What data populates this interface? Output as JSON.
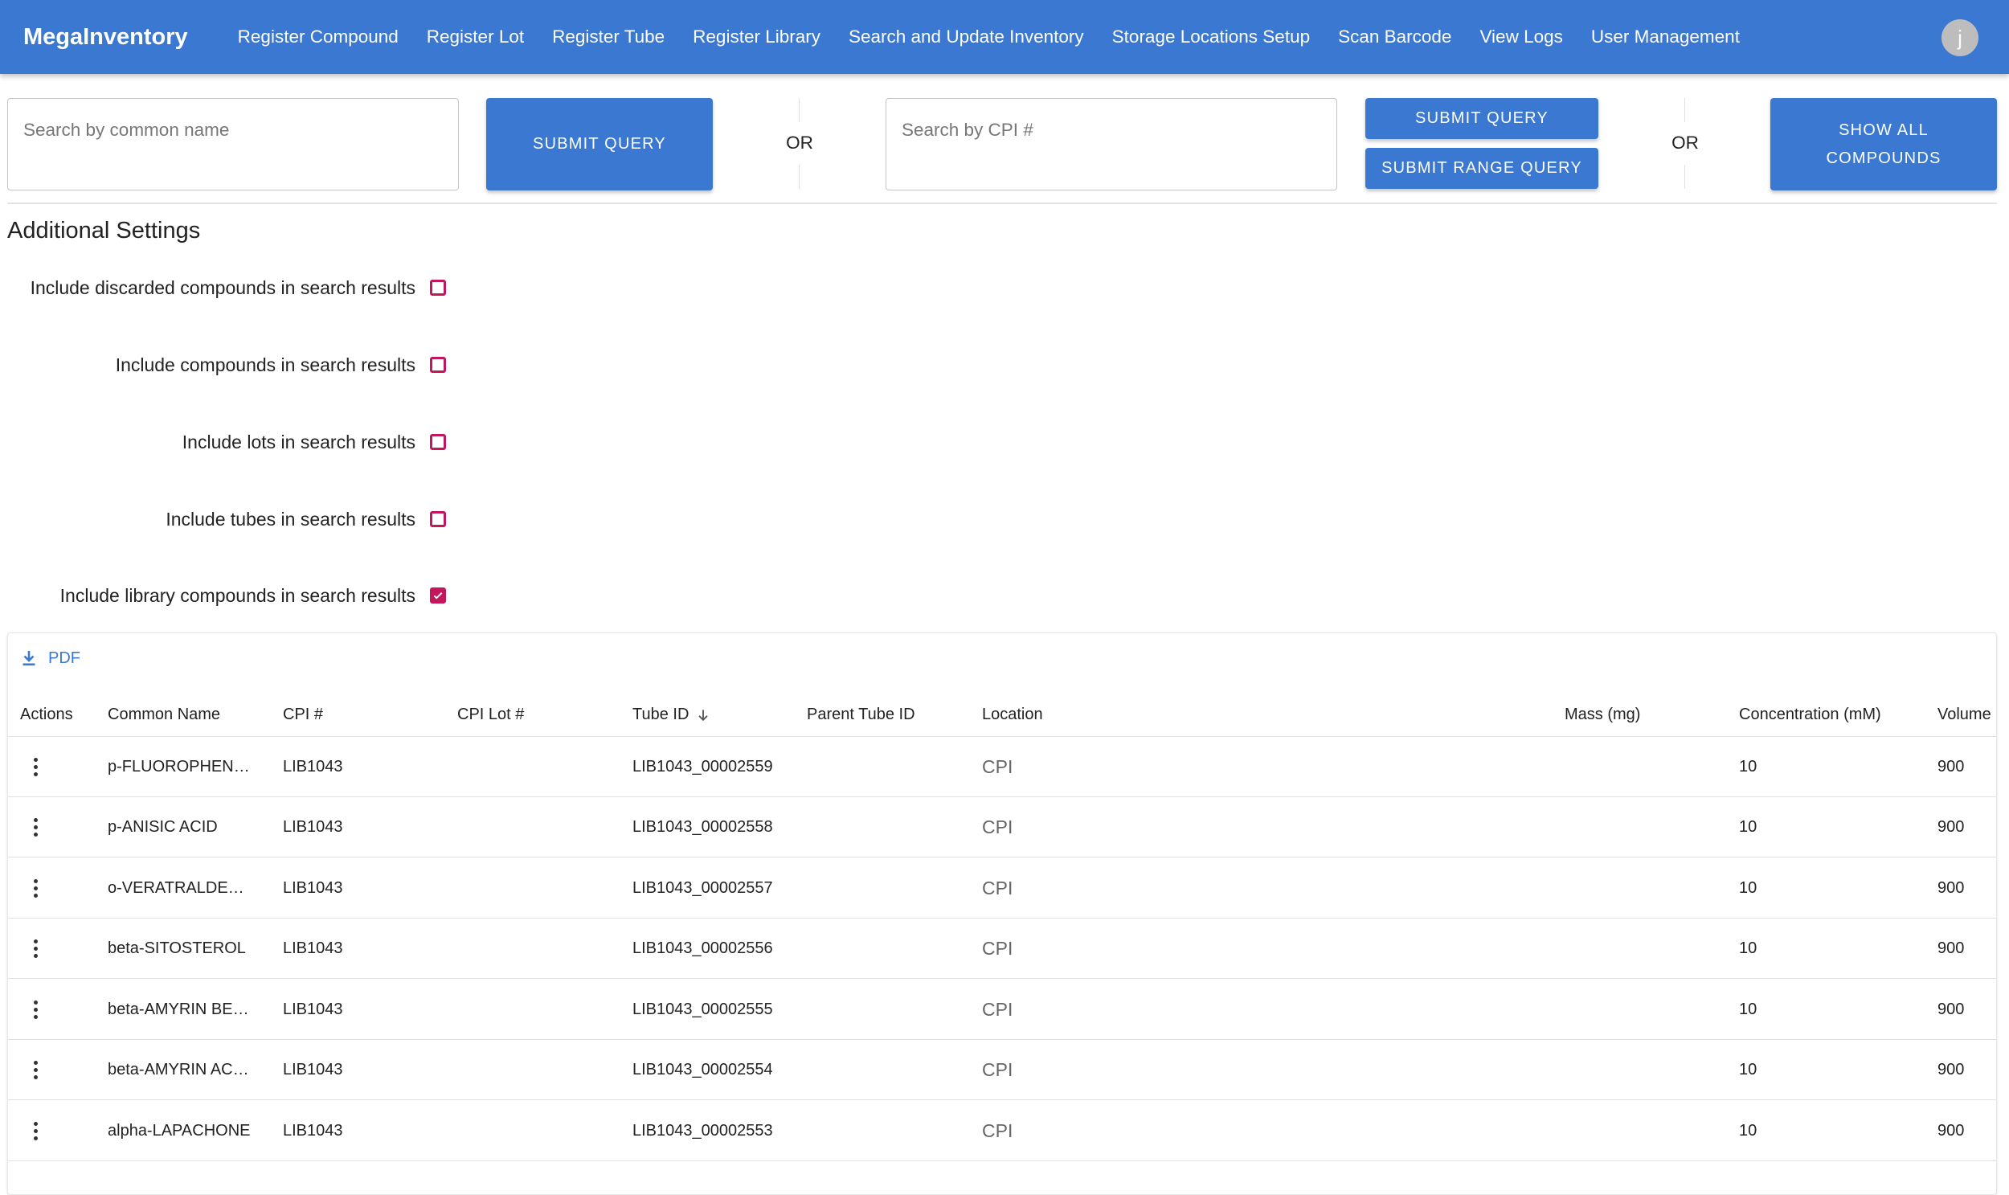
{
  "app": {
    "brand": "MegaInventory",
    "nav": [
      "Register Compound",
      "Register Lot",
      "Register Tube",
      "Register Library",
      "Search and Update Inventory",
      "Storage Locations Setup",
      "Scan Barcode",
      "View Logs",
      "User Management"
    ],
    "avatar_initial": "j"
  },
  "search": {
    "common_name_placeholder": "Search by common name",
    "common_name_value": "",
    "submit_query": "SUBMIT QUERY",
    "or_1": "OR",
    "cpi_placeholder": "Search by CPI #",
    "cpi_value": "",
    "submit_query_2": "SUBMIT QUERY",
    "submit_range_query": "SUBMIT RANGE QUERY",
    "or_2": "OR",
    "show_all_line1": "SHOW ALL",
    "show_all_line2": "COMPOUNDS"
  },
  "settings": {
    "title": "Additional Settings",
    "options": [
      {
        "label": "Include discarded compounds in search results",
        "checked": false
      },
      {
        "label": "Include compounds in search results",
        "checked": false
      },
      {
        "label": "Include lots in search results",
        "checked": false
      },
      {
        "label": "Include tubes in search results",
        "checked": false
      },
      {
        "label": "Include library compounds in search results",
        "checked": true
      }
    ]
  },
  "colors": {
    "primary": "#3a78d1",
    "checkbox": "#c2185b"
  },
  "table": {
    "export_label": "PDF",
    "export_icon": "download-icon",
    "sorted_column": "Tube ID",
    "sort_direction": "descending",
    "columns": [
      "Actions",
      "Common Name",
      "CPI #",
      "CPI Lot #",
      "Tube ID",
      "Parent Tube ID",
      "Location",
      "Mass (mg)",
      "Concentration (mM)",
      "Volume"
    ],
    "rows": [
      {
        "common_name": "p-FLUOROPHEN…",
        "cpi": "LIB1043",
        "cpi_lot": "",
        "tube_id": "LIB1043_00002559",
        "parent_tube_id": "",
        "location": "CPI",
        "mass": "",
        "concentration": "10",
        "volume": "900"
      },
      {
        "common_name": "p-ANISIC ACID",
        "cpi": "LIB1043",
        "cpi_lot": "",
        "tube_id": "LIB1043_00002558",
        "parent_tube_id": "",
        "location": "CPI",
        "mass": "",
        "concentration": "10",
        "volume": "900"
      },
      {
        "common_name": "o-VERATRALDE…",
        "cpi": "LIB1043",
        "cpi_lot": "",
        "tube_id": "LIB1043_00002557",
        "parent_tube_id": "",
        "location": "CPI",
        "mass": "",
        "concentration": "10",
        "volume": "900"
      },
      {
        "common_name": "beta-SITOSTEROL",
        "cpi": "LIB1043",
        "cpi_lot": "",
        "tube_id": "LIB1043_00002556",
        "parent_tube_id": "",
        "location": "CPI",
        "mass": "",
        "concentration": "10",
        "volume": "900"
      },
      {
        "common_name": "beta-AMYRIN BE…",
        "cpi": "LIB1043",
        "cpi_lot": "",
        "tube_id": "LIB1043_00002555",
        "parent_tube_id": "",
        "location": "CPI",
        "mass": "",
        "concentration": "10",
        "volume": "900"
      },
      {
        "common_name": "beta-AMYRIN AC…",
        "cpi": "LIB1043",
        "cpi_lot": "",
        "tube_id": "LIB1043_00002554",
        "parent_tube_id": "",
        "location": "CPI",
        "mass": "",
        "concentration": "10",
        "volume": "900"
      },
      {
        "common_name": "alpha-LAPACHONE",
        "cpi": "LIB1043",
        "cpi_lot": "",
        "tube_id": "LIB1043_00002553",
        "parent_tube_id": "",
        "location": "CPI",
        "mass": "",
        "concentration": "10",
        "volume": "900"
      }
    ]
  }
}
